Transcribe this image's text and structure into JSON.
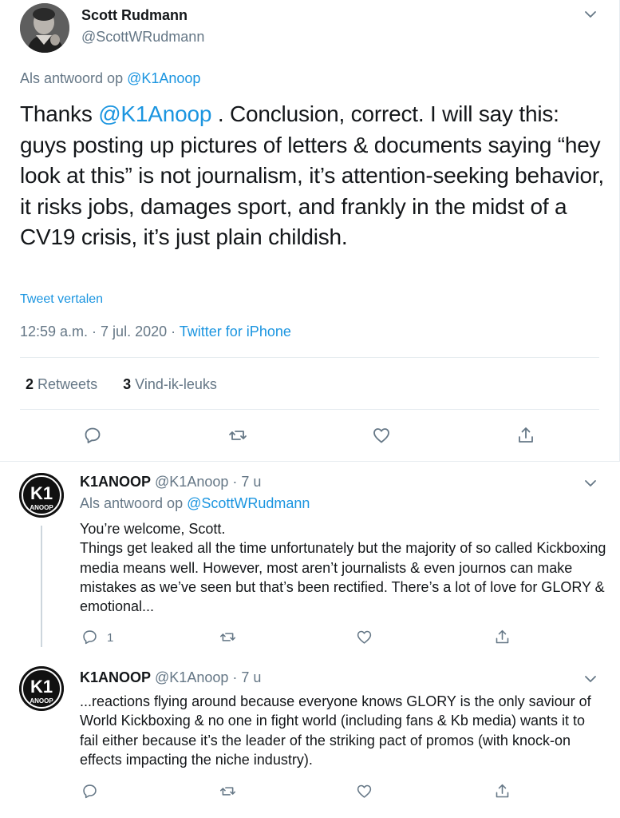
{
  "main_tweet": {
    "author_name": "Scott Rudmann",
    "author_handle": "@ScottWRudmann",
    "reply_prefix": "Als antwoord op",
    "reply_to": "@K1Anoop",
    "body_start": "Thanks ",
    "body_mention": "@K1Anoop",
    "body_rest": " . Conclusion, correct. I will say this: guys posting up pictures of letters & documents saying “hey look at this” is not journalism, it’s attention-seeking behavior, it risks jobs, damages sport, and frankly in the midst of a CV19 crisis, it’s just plain childish.",
    "translate": "Tweet vertalen",
    "timestamp": "12:59 a.m. · 7 jul. 2020",
    "separator": " · ",
    "source": "Twitter for iPhone",
    "retweets_count": "2",
    "retweets_label": "Retweets",
    "likes_count": "3",
    "likes_label": "Vind-ik-leuks"
  },
  "replies": [
    {
      "author_name": "K1ANOOP",
      "author_handle": "@K1Anoop",
      "time": " · 7 u",
      "reply_prefix": "Als antwoord op",
      "reply_to": "@ScottWRudmann",
      "body_line1": "You’re welcome, Scott.",
      "body_line2": "Things get leaked all the time unfortunately but the majority of so called Kickboxing media means well. However, most aren’t journalists & even journos can make mistakes as we’ve seen but that’s been rectified. There’s a lot of love for GLORY & emotional...",
      "reply_count": "1",
      "avatar_text": "K1",
      "avatar_sub": "ANOOP"
    },
    {
      "author_name": "K1ANOOP",
      "author_handle": "@K1Anoop",
      "time": " · 7 u",
      "body": "...reactions flying around because everyone knows GLORY is the only saviour of World Kickboxing & no one in fight world (including fans & Kb media) wants it to fail either because it’s the leader of the striking pact of promos (with knock-on effects impacting the niche industry).",
      "avatar_text": "K1",
      "avatar_sub": "ANOOP"
    }
  ],
  "icons": {
    "chevron": "chevron-down-icon",
    "reply": "reply-icon",
    "retweet": "retweet-icon",
    "like": "heart-icon",
    "share": "share-icon"
  },
  "colors": {
    "link": "#1b95e0",
    "secondary_text": "#657786",
    "primary_text": "#14171a",
    "border": "#e6ecf0"
  }
}
